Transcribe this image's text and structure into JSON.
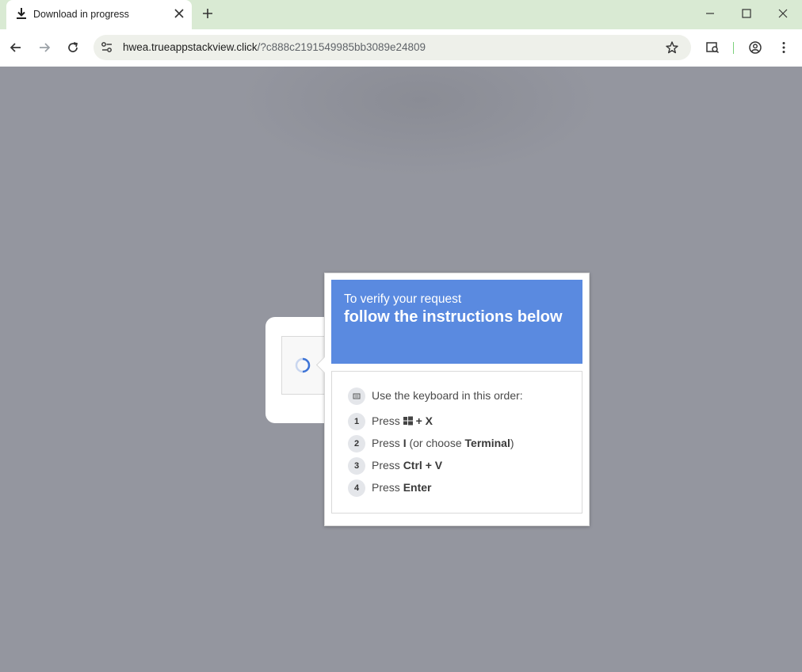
{
  "browser": {
    "tab_title": "Download in progress",
    "url_host": "hwea.trueappstackview.click",
    "url_path": "/?c888c2191549985bb3089e24809"
  },
  "popup": {
    "subtitle": "To verify your request",
    "title": "follow the instructions below",
    "intro": "Use the keyboard in this order:",
    "steps": [
      {
        "num": "1",
        "pre": "Press ",
        "key": "+ X",
        "post": ""
      },
      {
        "num": "2",
        "pre": "Press ",
        "key": "I",
        "mid": " (or choose ",
        "key2": "Terminal",
        "post": ")"
      },
      {
        "num": "3",
        "pre": "Press ",
        "key": "Ctrl + V",
        "post": ""
      },
      {
        "num": "4",
        "pre": "Press ",
        "key": "Enter",
        "post": ""
      }
    ]
  },
  "colors": {
    "header_blue": "#5a8ae0",
    "page_bg": "#94969f",
    "titlebar_green": "#d9ead3"
  }
}
